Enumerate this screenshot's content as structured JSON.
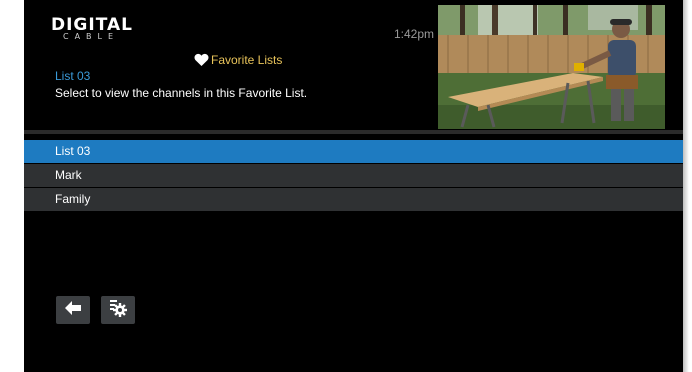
{
  "header": {
    "logo_main": "DIGITAL",
    "logo_sub": "CABLE",
    "clock": "1:42pm",
    "title": "Favorite Lists",
    "selected_name": "List 03",
    "description": "Select to view the channels in this Favorite List."
  },
  "list": {
    "items": [
      {
        "label": "List 03",
        "selected": true
      },
      {
        "label": "Mark",
        "selected": false
      },
      {
        "label": "Family",
        "selected": false
      }
    ]
  },
  "buttons": {
    "back_icon": "back-arrow-icon",
    "settings_icon": "settings-gear-icon"
  },
  "colors": {
    "accent_blue": "#1e7bc1",
    "title_gold": "#e8c35a",
    "selected_text_blue": "#3a9ad9",
    "item_bg": "#2f3133"
  }
}
